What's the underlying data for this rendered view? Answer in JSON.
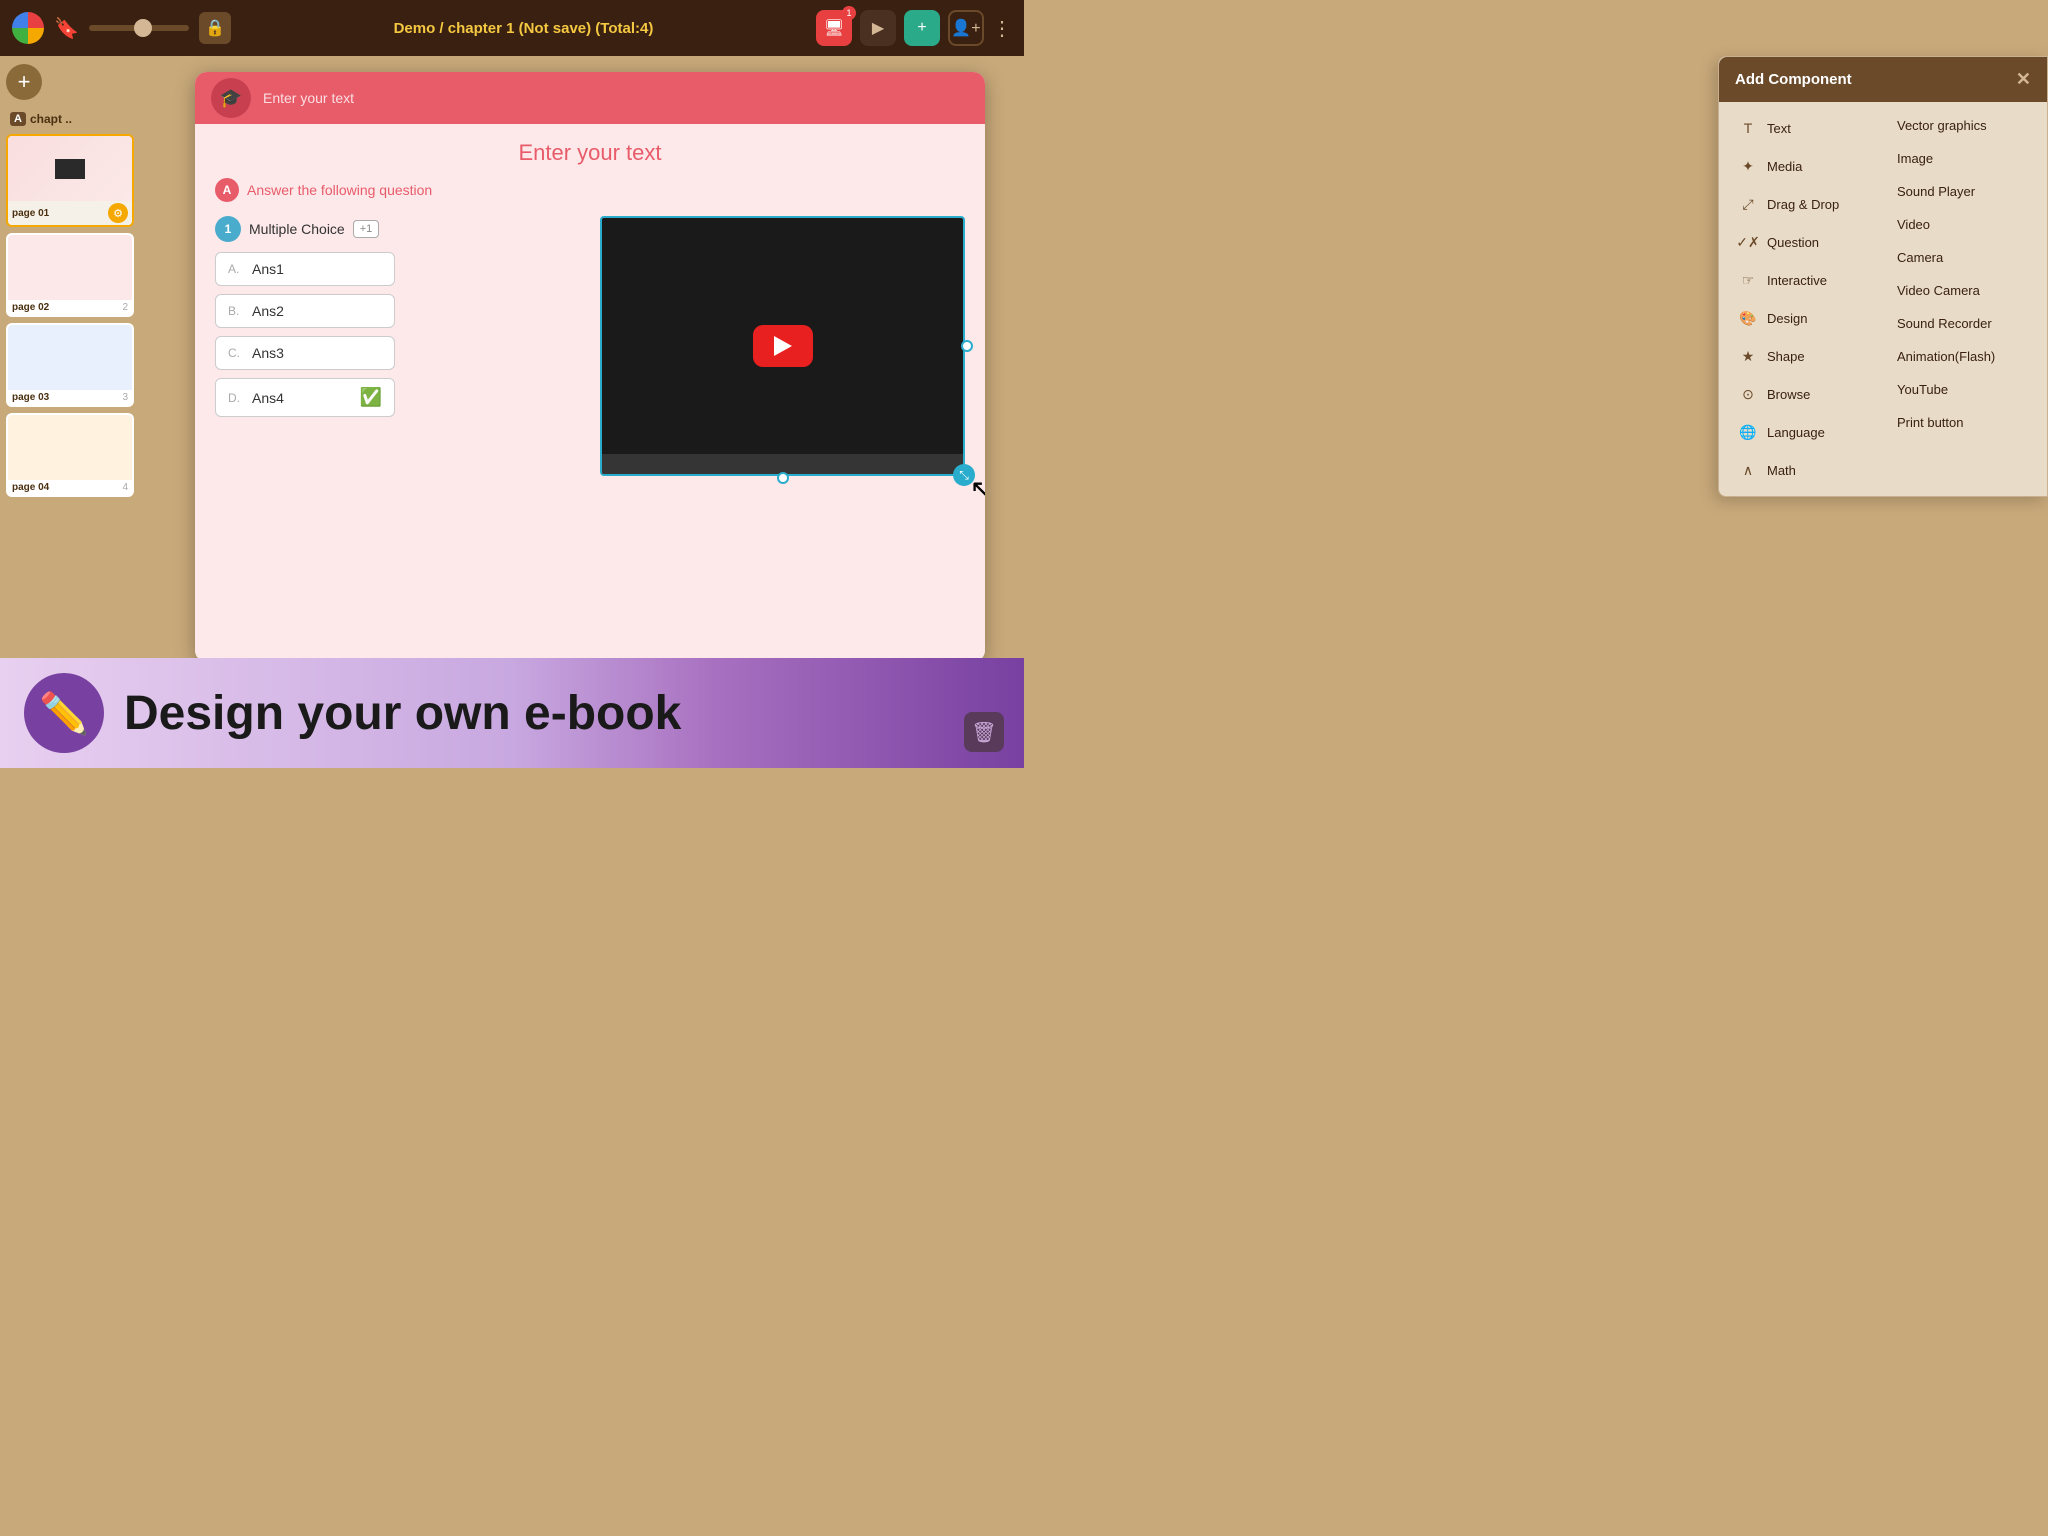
{
  "topbar": {
    "title": "Demo / chapter 1 (Not save) (Total:4)",
    "badge": "1",
    "dots_label": "⋮"
  },
  "sidebar": {
    "add_label": "+",
    "chapter_letter": "A",
    "chapter_name": "chapt ..",
    "pages": [
      {
        "label": "page 01",
        "num": "",
        "active": true
      },
      {
        "label": "page 02",
        "num": "2",
        "active": false
      },
      {
        "label": "page 03",
        "num": "3",
        "active": false
      },
      {
        "label": "page 04",
        "num": "4",
        "active": false
      }
    ]
  },
  "canvas": {
    "page_header_title": "Enter your text",
    "page_main_title": "Enter your text",
    "question_text": "Answer the following question",
    "mc_label": "Multiple Choice",
    "mc_plus": "+1",
    "answers": [
      {
        "letter": "A.",
        "text": "Ans1",
        "correct": false
      },
      {
        "letter": "B.",
        "text": "Ans2",
        "correct": false
      },
      {
        "letter": "C.",
        "text": "Ans3",
        "correct": false
      },
      {
        "letter": "D.",
        "text": "Ans4",
        "correct": true
      }
    ]
  },
  "add_component": {
    "title": "Add Component",
    "close": "✕",
    "left_items": [
      {
        "icon": "T",
        "label": "Text"
      },
      {
        "icon": "✦",
        "label": "Media"
      },
      {
        "icon": "⤢",
        "label": "Drag & Drop"
      },
      {
        "icon": "✓×",
        "label": "Question"
      },
      {
        "icon": "☞",
        "label": "Interactive"
      },
      {
        "icon": "🎨",
        "label": "Design"
      },
      {
        "icon": "★",
        "label": "Shape"
      },
      {
        "icon": "⊙",
        "label": "Browse"
      },
      {
        "icon": "🌐",
        "label": "Language"
      },
      {
        "icon": "∧",
        "label": "Math"
      }
    ],
    "right_items": [
      "Vector graphics",
      "Image",
      "Sound Player",
      "Video",
      "Camera",
      "Video Camera",
      "Sound Recorder",
      "Animation(Flash)",
      "YouTube",
      "Print button"
    ]
  },
  "banner": {
    "text": "Design your own e-book",
    "icon": "✏️"
  }
}
